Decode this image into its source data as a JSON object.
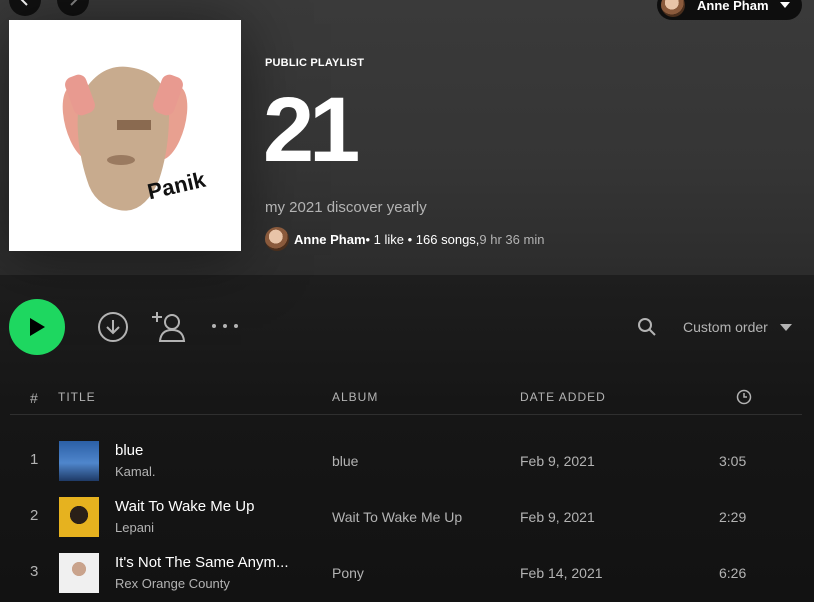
{
  "header": {
    "user_name": "Anne Pham"
  },
  "playlist": {
    "type_label": "PUBLIC PLAYLIST",
    "title": "21",
    "description": "my 2021 discover yearly",
    "owner": "Anne Pham",
    "stats": " • 1 like • 166 songs,",
    "duration": " 9 hr 36 min",
    "cover_text": "Panik"
  },
  "actions": {
    "sort_label": "Custom order"
  },
  "table": {
    "headers": {
      "num": "#",
      "title": "TITLE",
      "album": "ALBUM",
      "date_added": "DATE ADDED"
    },
    "rows": [
      {
        "num": "1",
        "title": "blue",
        "artist": "Kamal.",
        "album": "blue",
        "date_added": "Feb 9, 2021",
        "duration": "3:05"
      },
      {
        "num": "2",
        "title": "Wait To Wake Me Up",
        "artist": "Lepani",
        "album": "Wait To Wake Me Up",
        "date_added": "Feb 9, 2021",
        "duration": "2:29"
      },
      {
        "num": "3",
        "title": "It's Not The Same Anym...",
        "artist": "Rex Orange County",
        "album": "Pony",
        "date_added": "Feb 14, 2021",
        "duration": "6:26"
      }
    ]
  },
  "colors": {
    "accent": "#1ed760",
    "background": "#121212",
    "hero": "#353535",
    "secondary_text": "#b3b3b3"
  }
}
